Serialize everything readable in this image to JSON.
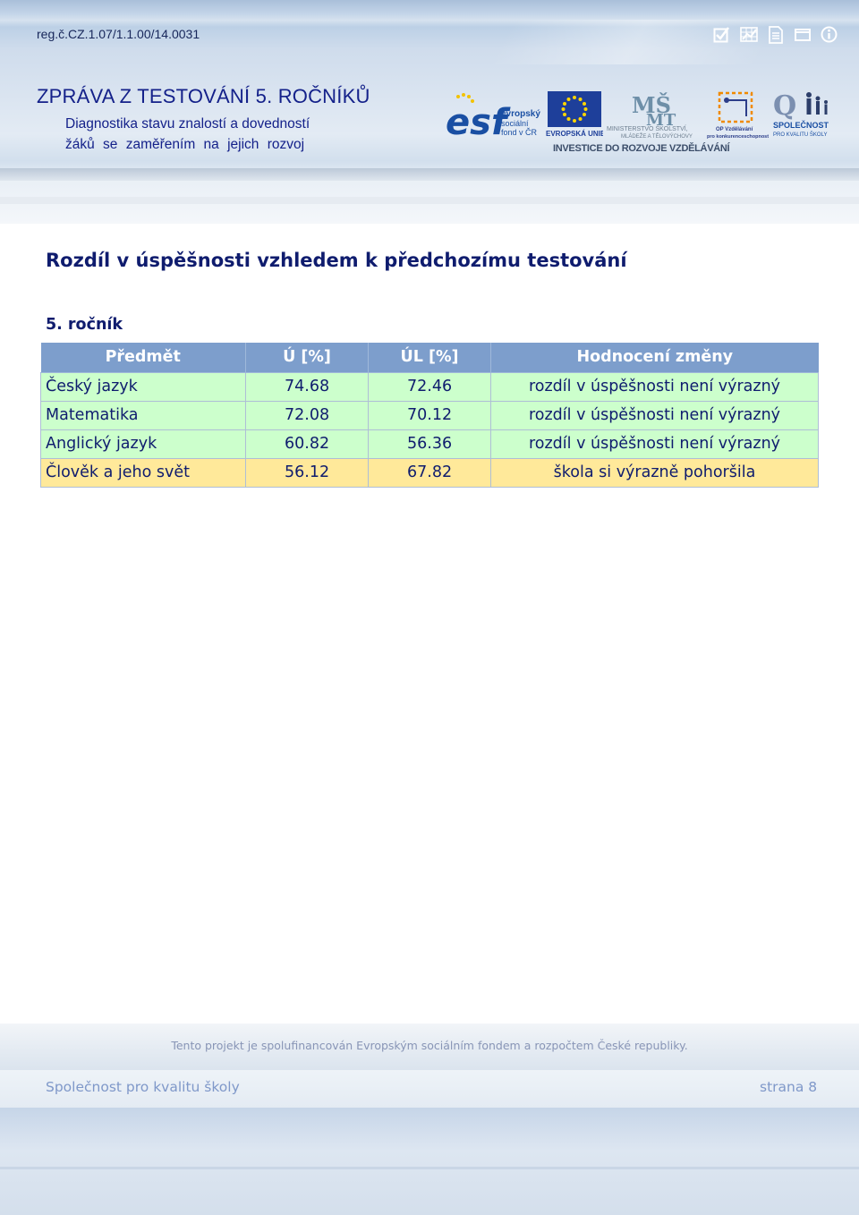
{
  "header": {
    "reg_number": "reg.č.CZ.1.07/1.1.00/14.0031",
    "title": "ZPRÁVA Z TESTOVÁNÍ 5. ROČNÍKŮ",
    "subtitle_line1": "Diagnostika stavu znalostí a dovedností",
    "subtitle_line2": "žáků se zaměřením na jejich rozvoj",
    "icons": [
      "checkbox-icon",
      "chart-icon",
      "document-icon",
      "window-icon",
      "info-icon"
    ],
    "logos": {
      "esf_word": "esf",
      "esf_text": [
        "evropský",
        "sociální",
        "fond v ČR"
      ],
      "eu_text": "EVROPSKÁ UNIE",
      "msmt_text": [
        "MINISTERSTVO ŠKOLSTVÍ,",
        "MLÁDEŽE A TĚLOVÝCHOVY"
      ],
      "op_text": [
        "OP Vzdělávání",
        "pro konkurenceschopnost"
      ],
      "q_text": [
        "SPOLEČNOST",
        "PRO KVALITU ŠKOLY"
      ],
      "investice": "INVESTICE DO ROZVOJE VZDĚLÁVÁNÍ"
    }
  },
  "content": {
    "heading": "Rozdíl v úspěšnosti vzhledem k předchozímu testování",
    "grade": "5. ročník",
    "table": {
      "headers": [
        "Předmět",
        "Ú [%]",
        "ÚL [%]",
        "Hodnocení změny"
      ],
      "rows": [
        {
          "subject": "Český jazyk",
          "u": "74.68",
          "ul": "72.46",
          "evaluation": "rozdíl v úspěšnosti není výrazný",
          "status": "ok"
        },
        {
          "subject": "Matematika",
          "u": "72.08",
          "ul": "70.12",
          "evaluation": "rozdíl v úspěšnosti není výrazný",
          "status": "ok"
        },
        {
          "subject": "Anglický jazyk",
          "u": "60.82",
          "ul": "56.36",
          "evaluation": "rozdíl v úspěšnosti není výrazný",
          "status": "ok"
        },
        {
          "subject": "Člověk a jeho svět",
          "u": "56.12",
          "ul": "67.82",
          "evaluation": "škola si výrazně pohoršila",
          "status": "bad"
        }
      ]
    }
  },
  "footer": {
    "note": "Tento projekt je spolufinancován Evropským sociálním fondem a rozpočtem České republiky.",
    "organization": "Společnost pro kvalitu školy",
    "page": "strana 8"
  },
  "colors": {
    "header_blue": "#14218a",
    "table_header_bg": "#7d9ecc",
    "row_ok_bg": "#ccffcc",
    "row_bad_bg": "#ffe99a",
    "footer_text": "#7f98c9"
  }
}
